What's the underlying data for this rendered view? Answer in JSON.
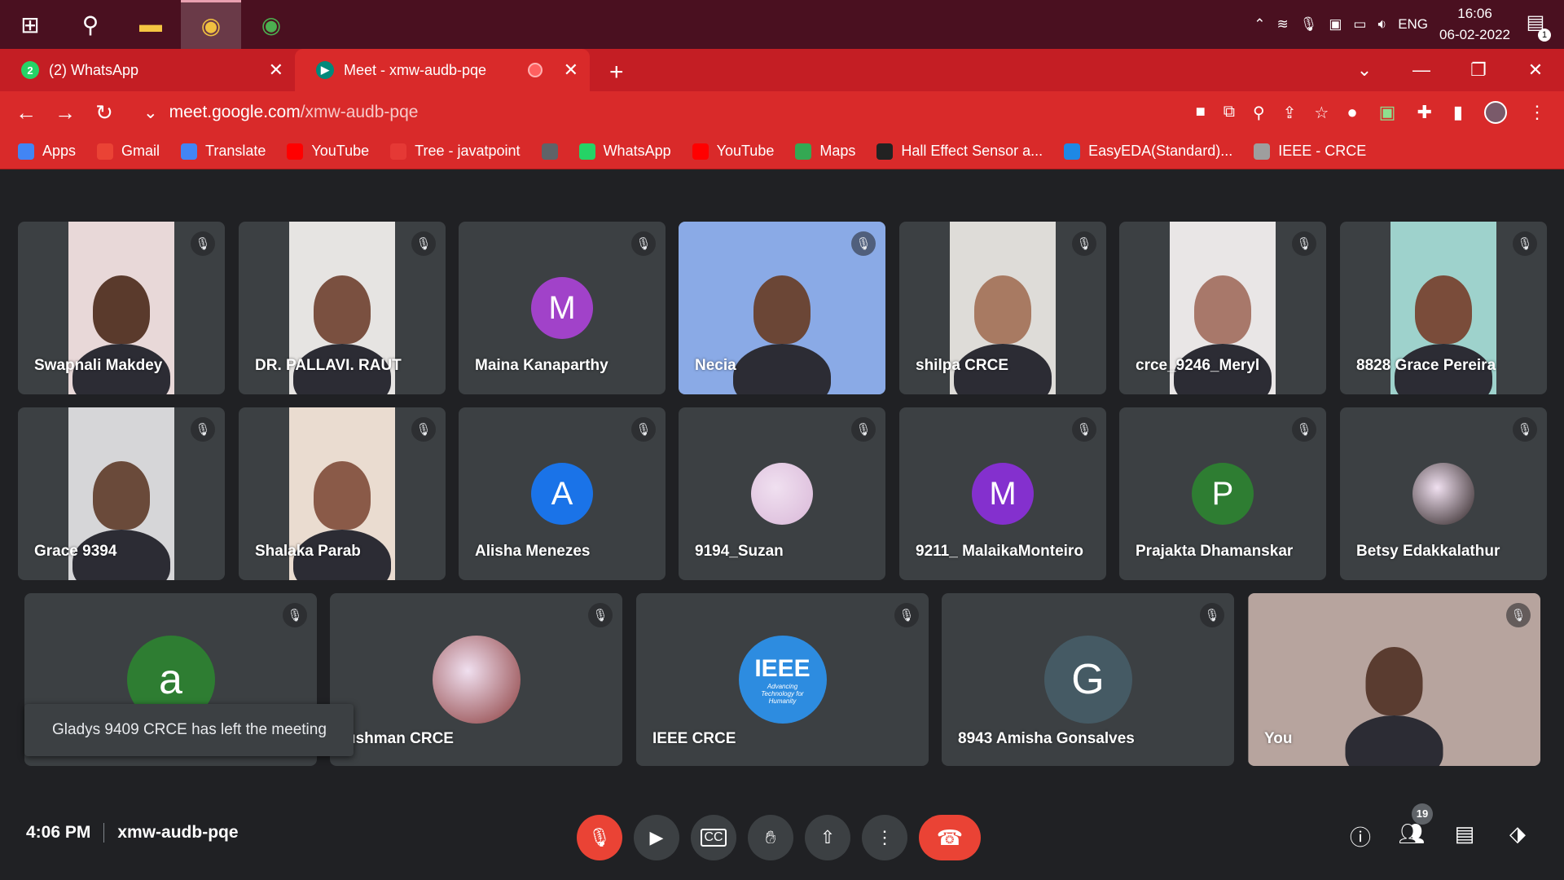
{
  "taskbar": {
    "language": "ENG",
    "time": "16:06",
    "date": "06-02-2022",
    "notification_count": "1"
  },
  "tabs": [
    {
      "title": "(2) WhatsApp",
      "favicon_badge": "2",
      "color": "#25d366"
    },
    {
      "title": "Meet - xmw-audb-pqe",
      "color": "#00897b"
    }
  ],
  "address": {
    "host": "meet.google.com",
    "path": "/xmw-audb-pqe"
  },
  "bookmarks": [
    {
      "label": "Apps",
      "icon": "apps-grid-icon",
      "color": "#4285f4"
    },
    {
      "label": "Gmail",
      "icon": "gmail-icon",
      "color": "#ea4335"
    },
    {
      "label": "Translate",
      "icon": "translate-icon",
      "color": "#4285f4"
    },
    {
      "label": "YouTube",
      "icon": "youtube-icon",
      "color": "#ff0000"
    },
    {
      "label": "Tree - javatpoint",
      "icon": "javatpoint-icon",
      "color": "#e53935"
    },
    {
      "label": "",
      "icon": "globe-icon",
      "color": "#5f6368"
    },
    {
      "label": "WhatsApp",
      "icon": "whatsapp-icon",
      "color": "#25d366"
    },
    {
      "label": "YouTube",
      "icon": "youtube-icon",
      "color": "#ff0000"
    },
    {
      "label": "Maps",
      "icon": "maps-icon",
      "color": "#34a853"
    },
    {
      "label": "Hall Effect Sensor a...",
      "icon": "site-icon",
      "color": "#222222"
    },
    {
      "label": "EasyEDA(Standard)...",
      "icon": "easyeda-icon",
      "color": "#1e88e5"
    },
    {
      "label": "IEEE - CRCE",
      "icon": "ieee-icon",
      "color": "#9e9e9e"
    }
  ],
  "participants": [
    {
      "name": "Swapnali Makdey",
      "type": "video",
      "bg": "#e8d8d8",
      "skin": "#5a3a2c"
    },
    {
      "name": "DR. PALLAVI. RAUT",
      "type": "video",
      "bg": "#e6e4e2",
      "skin": "#7a5040"
    },
    {
      "name": "Maina Kanaparthy",
      "type": "initial",
      "initial": "M",
      "color": "#a142c9"
    },
    {
      "name": "Necia",
      "type": "video",
      "bg": "#8aaae6",
      "skin": "#6b4636"
    },
    {
      "name": "shilpa CRCE",
      "type": "video",
      "bg": "#dedcd8",
      "skin": "#a87a62"
    },
    {
      "name": "crce_9246_Meryl",
      "type": "video",
      "bg": "#e9e6e6",
      "skin": "#a8786a"
    },
    {
      "name": "8828 Grace Pereira",
      "type": "video",
      "bg": "#9ed2cc",
      "skin": "#7a4c3a"
    },
    {
      "name": "Grace 9394",
      "type": "video",
      "bg": "#d6d6d8",
      "skin": "#6a4a3a"
    },
    {
      "name": "Shalaka Parab",
      "type": "video",
      "bg": "#eadcd0",
      "skin": "#8a5a48"
    },
    {
      "name": "Alisha Menezes",
      "type": "initial",
      "initial": "A",
      "color": "#1a73e8"
    },
    {
      "name": "9194_Suzan",
      "type": "photo",
      "color": "#d9b8d8"
    },
    {
      "name": "9211_ MalaikaMonteiro",
      "type": "initial",
      "initial": "M",
      "color": "#8430ce"
    },
    {
      "name": "Prajakta Dhamanskar",
      "type": "initial",
      "initial": "P",
      "color": "#2e7d32"
    },
    {
      "name": "Betsy Edakkalathur",
      "type": "photo",
      "color": "#2a2020"
    },
    {
      "name": "",
      "type": "initial",
      "initial": "a",
      "color": "#2e7d32"
    },
    {
      "name": "ushman CRCE",
      "type": "photo",
      "color": "#8a3a3a"
    },
    {
      "name": "IEEE CRCE",
      "type": "logo",
      "logo_text": "IEEE",
      "logo_tagline": "Advancing Technology for Humanity",
      "color": "#2d8ce0"
    },
    {
      "name": "8943 Amisha Gonsalves",
      "type": "initial",
      "initial": "G",
      "color": "#455a64"
    },
    {
      "name": "You",
      "type": "video",
      "bg": "#b7a49e",
      "skin": "#5a3c30"
    }
  ],
  "toast": "Gladys 9409 CRCE has left the meeting",
  "meeting": {
    "time": "4:06 PM",
    "code": "xmw-audb-pqe"
  },
  "participant_count": "19",
  "colors": {
    "chrome_red": "#d92a2a",
    "meet_bg": "#202124",
    "tile_bg": "#3c4043",
    "end_call_red": "#ea4335"
  }
}
